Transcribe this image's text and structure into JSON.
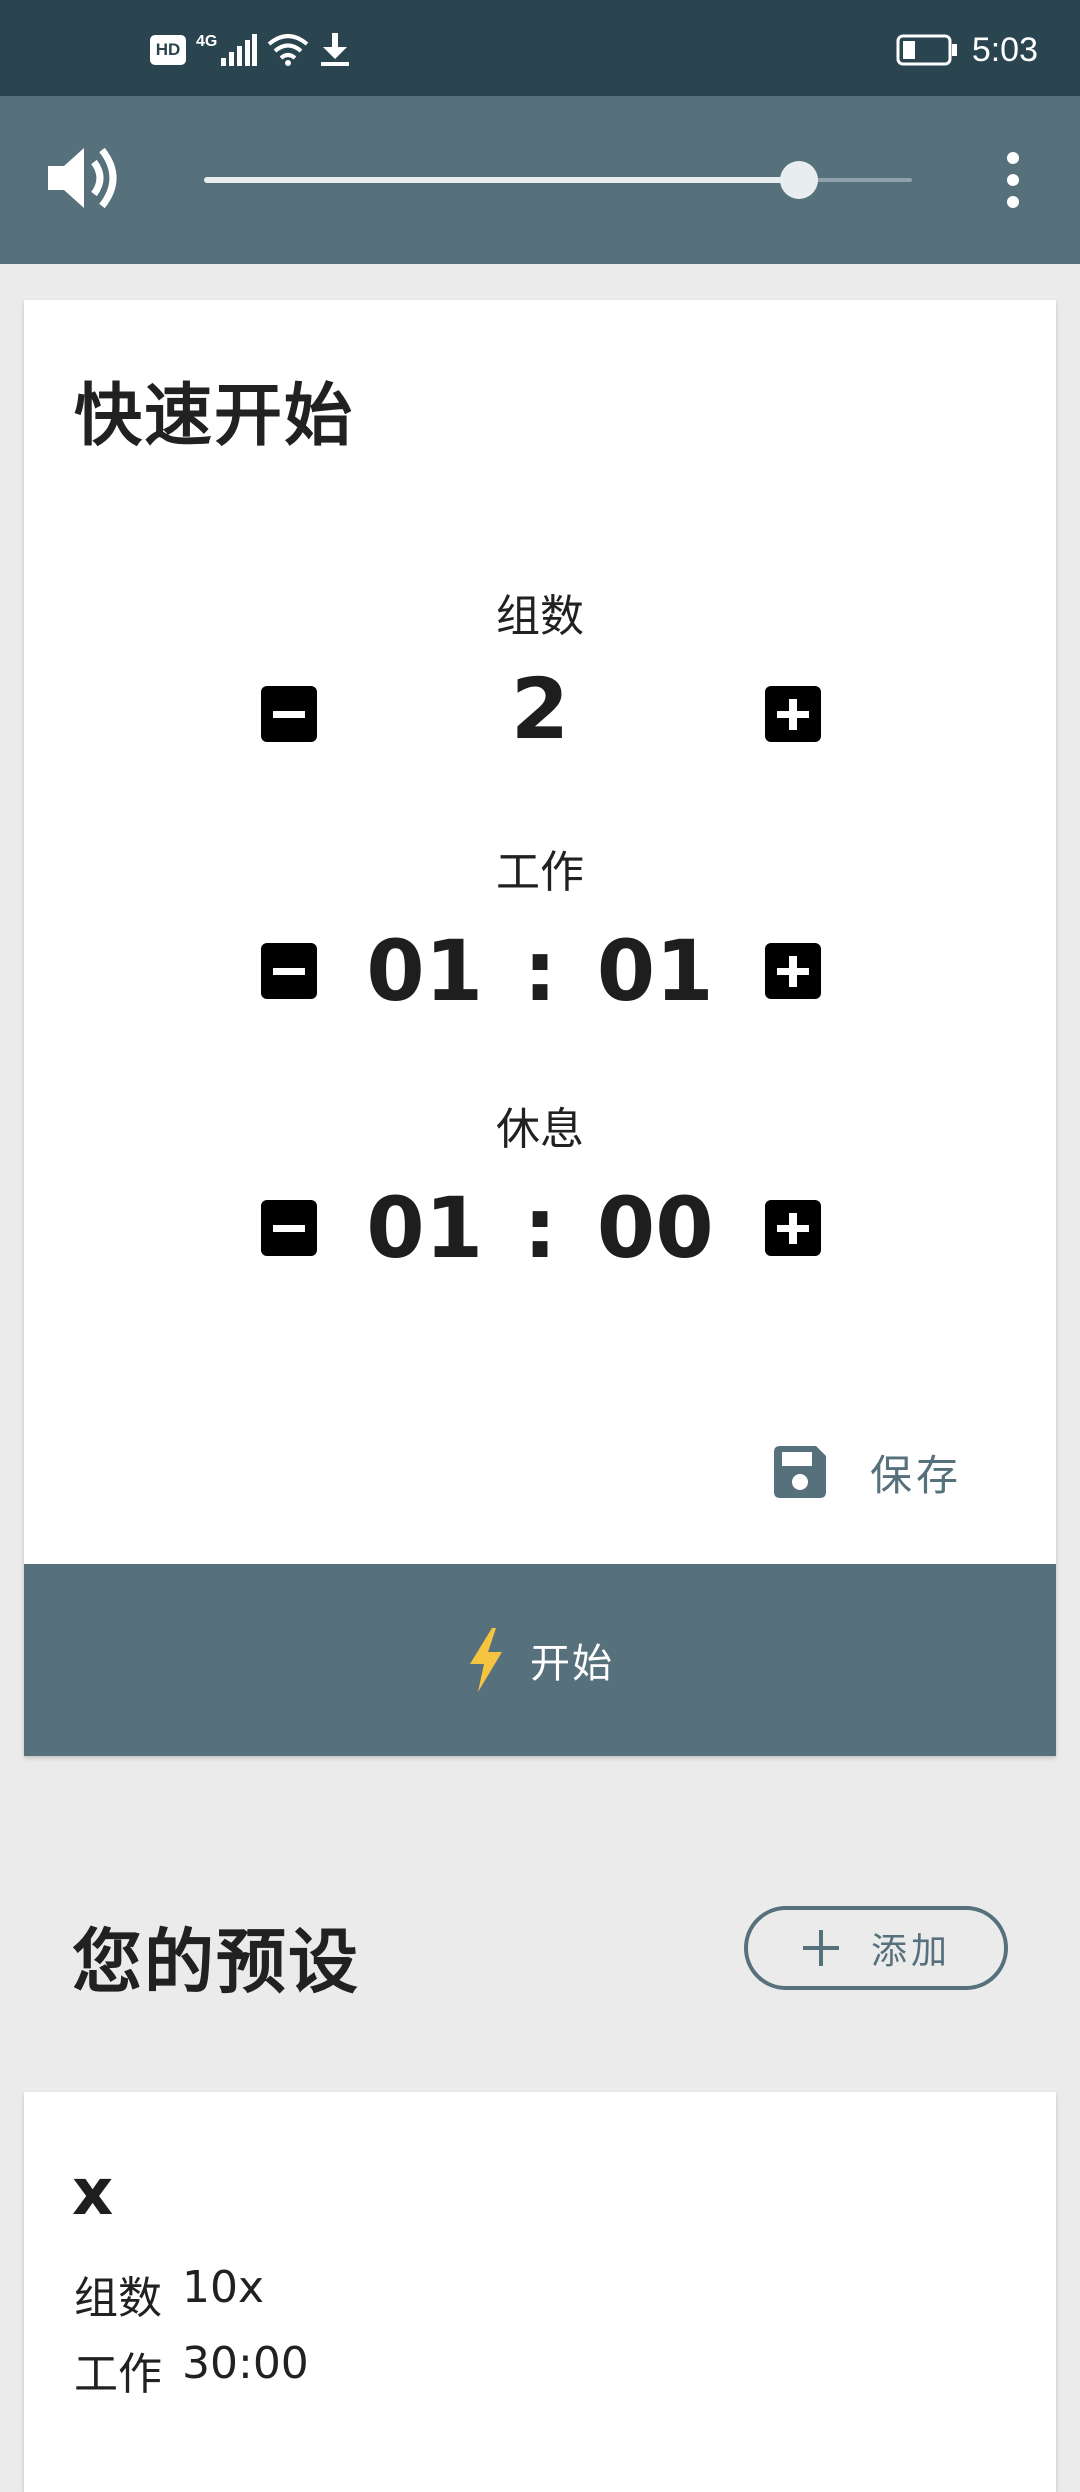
{
  "status_bar": {
    "hd_badge": "HD",
    "network": "4G",
    "time": "5:03",
    "icons": [
      "hd-icon",
      "signal-icon",
      "wifi-icon",
      "download-icon",
      "battery-icon"
    ]
  },
  "toolbar": {
    "volume_icon": "volume-icon",
    "volume_level": 0.84,
    "menu_icon": "more-vert-icon"
  },
  "quick_start": {
    "title": "快速开始",
    "sets": {
      "label": "组数",
      "value": "2"
    },
    "work": {
      "label": "工作",
      "minutes": "01",
      "colon": ":",
      "seconds": "01"
    },
    "rest": {
      "label": "休息",
      "minutes": "01",
      "colon": ":",
      "seconds": "00"
    },
    "save_label": "保存",
    "start_label": "开始"
  },
  "presets": {
    "title": "您的预设",
    "add_label": "添加",
    "items": [
      {
        "name": "x",
        "sets_label": "组数",
        "sets_value": "10x",
        "work_label": "工作",
        "work_value": "30:00"
      }
    ]
  },
  "colors": {
    "status_bar": "#2a4450",
    "primary": "#56707c",
    "background": "#ebebeb",
    "card": "#ffffff",
    "bolt": "#f5c542"
  }
}
